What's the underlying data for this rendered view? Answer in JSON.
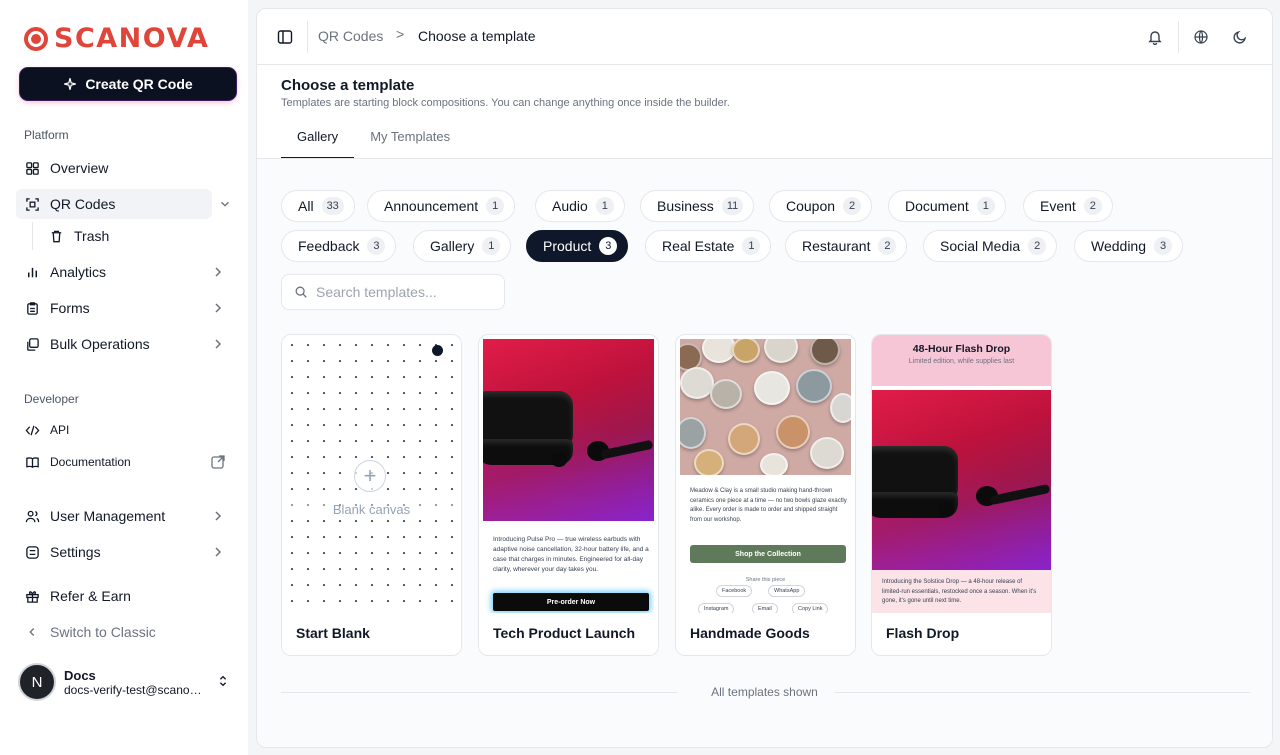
{
  "brand": {
    "name": "SCANOVA",
    "color": "#e0453a"
  },
  "sidebar": {
    "create_button": "Create QR Code",
    "platform_label": "Platform",
    "developer_label": "Developer",
    "items": {
      "overview": "Overview",
      "qr_codes": "QR Codes",
      "trash": "Trash",
      "analytics": "Analytics",
      "forms": "Forms",
      "bulk": "Bulk Operations",
      "api": "API",
      "documentation": "Documentation",
      "user_management": "User Management",
      "settings": "Settings",
      "refer": "Refer & Earn",
      "switch_classic": "Switch to Classic"
    },
    "user": {
      "initial": "N",
      "name": "Docs",
      "email": "docs-verify-test@scanova.io"
    }
  },
  "breadcrumb": {
    "parent": "QR Codes",
    "separator": ">",
    "current": "Choose a template"
  },
  "page": {
    "title": "Choose a template",
    "subtitle": "Templates are starting block compositions. You can change anything once inside the builder."
  },
  "tabs": [
    "Gallery",
    "My Templates"
  ],
  "active_tab": "Gallery",
  "categories": [
    {
      "label": "All",
      "count": "33"
    },
    {
      "label": "Announcement",
      "count": "1"
    },
    {
      "label": "Audio",
      "count": "1"
    },
    {
      "label": "Business",
      "count": "11"
    },
    {
      "label": "Coupon",
      "count": "2"
    },
    {
      "label": "Document",
      "count": "1"
    },
    {
      "label": "Event",
      "count": "2"
    },
    {
      "label": "Feedback",
      "count": "3"
    },
    {
      "label": "Gallery",
      "count": "1"
    },
    {
      "label": "Product",
      "count": "3"
    },
    {
      "label": "Real Estate",
      "count": "1"
    },
    {
      "label": "Restaurant",
      "count": "2"
    },
    {
      "label": "Social Media",
      "count": "2"
    },
    {
      "label": "Wedding",
      "count": "3"
    }
  ],
  "selected_category": "Product",
  "search": {
    "placeholder": "Search templates..."
  },
  "templates": {
    "blank": {
      "name": "Start Blank",
      "canvas_label": "Blank canvas",
      "plus": "+"
    },
    "tech": {
      "name": "Tech Product Launch",
      "body": "Introducing Pulse Pro — true wireless earbuds with adaptive noise cancellation, 32-hour battery life, and a case that charges in minutes. Engineered for all-day clarity, wherever your day takes you.",
      "button": "Pre-order Now"
    },
    "handmade": {
      "name": "Handmade Goods",
      "body": "Meadow & Clay is a small studio making hand-thrown ceramics one piece at a time — no two bowls glaze exactly alike. Every order is made to order and shipped straight from our workshop.",
      "button": "Shop the Collection",
      "share_label": "Share this piece",
      "share": [
        "Facebook",
        "WhatsApp",
        "Instagram",
        "Email",
        "Copy Link"
      ]
    },
    "flash": {
      "name": "Flash Drop",
      "title": "48-Hour Flash Drop",
      "subtitle": "Limited edition, while supplies last",
      "body": "Introducing the Solstice Drop — a 48-hour release of limited-run essentials, restocked once a season. When it's gone, it's gone until next time."
    }
  },
  "footer": "All templates shown",
  "colors": {
    "dark": "#0f172a",
    "accent_green": "#5f7a5a",
    "flash_pink": "#f6c6d6"
  }
}
